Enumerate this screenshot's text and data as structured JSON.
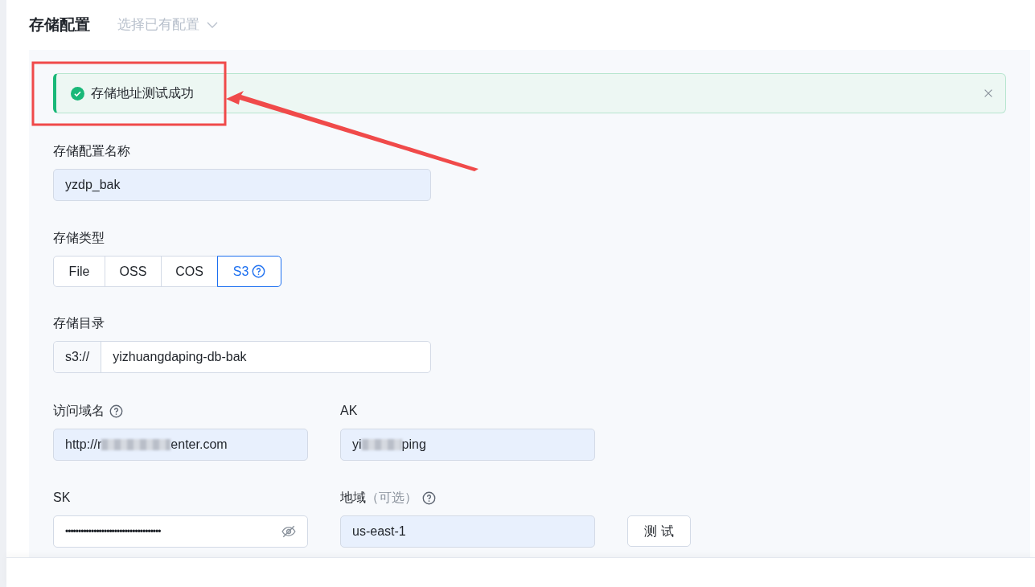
{
  "header": {
    "title": "存储配置",
    "preset_select": {
      "placeholder": "选择已有配置"
    }
  },
  "alert": {
    "kind": "success",
    "message": "存储地址测试成功",
    "closable": true
  },
  "annotation": {
    "color": "#f04a4a"
  },
  "fields": {
    "name": {
      "label": "存储配置名称",
      "value": "yzdp_bak",
      "autofilled": true
    },
    "type": {
      "label": "存储类型",
      "options": [
        {
          "label": "File",
          "selected": false,
          "help": false
        },
        {
          "label": "OSS",
          "selected": false,
          "help": false
        },
        {
          "label": "COS",
          "selected": false,
          "help": false
        },
        {
          "label": "S3",
          "selected": true,
          "help": true
        }
      ]
    },
    "directory": {
      "label": "存储目录",
      "prefix": "s3://",
      "value": "yizhuangdaping-db-bak",
      "autofilled": false
    },
    "endpoint": {
      "label": "访问域名",
      "help": true,
      "value_start": "http://r",
      "value_end": "enter.com",
      "blurred": true,
      "autofilled": true
    },
    "ak": {
      "label": "AK",
      "value_start": "yi",
      "value_end": "ping",
      "blurred": true,
      "autofilled": true
    },
    "sk": {
      "label": "SK",
      "value": "•••••••••••••••••••••••••••••••••••••",
      "masked": true,
      "autofilled": false
    },
    "region": {
      "label": "地域",
      "hint": "（可选）",
      "help": true,
      "value": "us-east-1",
      "autofilled": true
    }
  },
  "test_button": {
    "label": "测 试"
  }
}
